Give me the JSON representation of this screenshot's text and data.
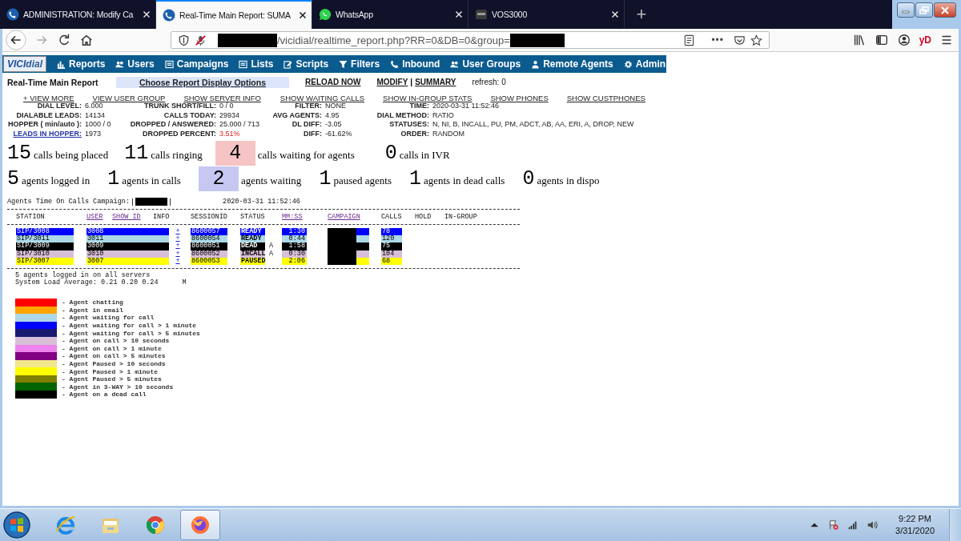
{
  "browser": {
    "tabs": [
      {
        "title": "ADMINISTRATION: Modify Ca",
        "kind": "vicidial",
        "selected": false
      },
      {
        "title": "Real-Time Main Report: SUMA",
        "kind": "vicidial",
        "selected": true
      },
      {
        "title": "WhatsApp",
        "kind": "whatsapp",
        "selected": false
      },
      {
        "title": "VOS3000",
        "kind": "vos",
        "selected": false
      }
    ],
    "new_tab": "+",
    "url": "/vicidial/realtime_report.php?RR=0&DB=0&group=",
    "more": "•••",
    "account_badge": "yD"
  },
  "menu": {
    "logo": {
      "bold": "VICI",
      "rest": "dial"
    },
    "items": [
      {
        "label": "Reports",
        "kind": "report"
      },
      {
        "label": "Users",
        "kind": "users"
      },
      {
        "label": "Campaigns",
        "kind": "list"
      },
      {
        "label": "Lists",
        "kind": "list"
      },
      {
        "label": "Scripts",
        "kind": "edit"
      },
      {
        "label": "Filters",
        "kind": "filter"
      },
      {
        "label": "Inbound",
        "kind": "phone"
      },
      {
        "label": "User Groups",
        "kind": "users"
      },
      {
        "label": "Remote Agents",
        "kind": "agent"
      },
      {
        "label": "Admin",
        "kind": "gear"
      }
    ]
  },
  "report": {
    "title": "Real-Time Main Report",
    "options_button": "Choose Report Display Options",
    "reload": "RELOAD NOW",
    "modify": "MODIFY",
    "separator": "|",
    "summary": "SUMMARY",
    "refresh": "refresh: 0",
    "links": [
      "+ VIEW MORE",
      "VIEW USER GROUP",
      "SHOW SERVER INFO",
      "SHOW WAITING CALLS",
      "SHOW IN-GROUP STATS",
      "SHOW PHONES",
      "SHOW CUSTPHONES"
    ],
    "stats": [
      [
        {
          "label": "DIAL LEVEL:",
          "value": "6.000"
        },
        {
          "label": "TRUNK SHORT/FILL:",
          "value": "0 / 0"
        },
        {
          "label": "FILTER:",
          "value": "NONE"
        },
        {
          "label": "TIME:",
          "value": "2020-03-31 11:52:46"
        }
      ],
      [
        {
          "label": "DIALABLE LEADS:",
          "value": "14134"
        },
        {
          "label": "CALLS TODAY:",
          "value": "29934"
        },
        {
          "label": "AVG AGENTS:",
          "value": "4.95"
        },
        {
          "label": "DIAL METHOD:",
          "value": "RATIO"
        }
      ],
      [
        {
          "label": "HOPPER ( min/auto ):",
          "value": "1000 / 0"
        },
        {
          "label": "DROPPED / ANSWERED:",
          "value": "25.000 / 713"
        },
        {
          "label": "DL DIFF:",
          "value": "-3.05"
        },
        {
          "label": "STATUSES:",
          "value": "N, NI, B, INCALL, PU, PM, ADCT, AB, AA, ERI, A, DROP, NEW"
        }
      ],
      [
        {
          "label": "LEADS IN HOPPER:",
          "value": "1973",
          "link": true
        },
        {
          "label": "DROPPED PERCENT:",
          "value": "3.51%",
          "alert": true
        },
        {
          "label": "DIFF:",
          "value": "-61.62%"
        },
        {
          "label": "ORDER:",
          "value": "RANDOM"
        }
      ]
    ]
  },
  "call_counts": [
    {
      "count": "15",
      "label": "calls being placed"
    },
    {
      "count": "11",
      "label": "calls ringing"
    },
    {
      "count": "4",
      "label": "calls waiting for agents",
      "color": "#f6c4c4"
    },
    {
      "count": "0",
      "label": "calls in IVR"
    }
  ],
  "agent_counts": [
    {
      "count": "5",
      "label": "agents logged in"
    },
    {
      "count": "1",
      "label": "agents in calls"
    },
    {
      "count": "2",
      "label": "agents waiting",
      "color": "#c6c8f2"
    },
    {
      "count": "1",
      "label": "paused agents"
    },
    {
      "count": "1",
      "label": "agents in dead calls"
    },
    {
      "count": "0",
      "label": "agents in dispo"
    }
  ],
  "agents": {
    "caption": "Agents Time On Calls Campaign:",
    "time": "2020-03-31 11:52:46",
    "columns": [
      {
        "label": "STATION",
        "link": false
      },
      {
        "label": "USER",
        "link": true
      },
      {
        "label": "SHOW ID",
        "link": true
      },
      {
        "label": "INFO",
        "link": false
      },
      {
        "label": "SESSIONID",
        "link": false
      },
      {
        "label": "STATUS",
        "link": false
      },
      {
        "label": "MM:SS",
        "link": true
      },
      {
        "label": "CAMPAIGN",
        "link": true
      },
      {
        "label": "CALLS",
        "link": false
      },
      {
        "label": "HOLD",
        "link": false
      },
      {
        "label": "IN-GROUP",
        "link": false
      }
    ],
    "rows": [
      {
        "station": "SIP/3008",
        "user": "3008",
        "info": "+",
        "session": "8600057",
        "status": "READY",
        "time": "1:30",
        "calls": "78",
        "color": "#0000ff"
      },
      {
        "station": "SIP/3011",
        "user": "3011",
        "info": "+",
        "session": "8600054",
        "status": "READY",
        "time": "0:44",
        "calls": "120",
        "color": "#add8e6"
      },
      {
        "station": "SIP/3009",
        "user": "3009",
        "info": "+",
        "session": "8600051",
        "status": "DEAD",
        "call_type": "A",
        "time": "1:58",
        "calls": "75",
        "color": "#000000"
      },
      {
        "station": "SIP/3010",
        "user": "3010",
        "info": "+",
        "session": "8600052",
        "status": "INCALL",
        "call_type": "A",
        "time": "0:30",
        "calls": "104",
        "color": "#d8bfd8"
      },
      {
        "station": "SIP/3007",
        "user": "3007",
        "info": "+",
        "session": "8600053",
        "status": "PAUSED",
        "time": "2:06",
        "calls": "68",
        "color": "#ffff00"
      }
    ],
    "summary": [
      "5 agents logged in on all servers",
      "System Load Average: 0.21 0.20 0.24"
    ],
    "load_flag": "M"
  },
  "legend": [
    {
      "color": "#ff0000",
      "label": "- Agent chatting"
    },
    {
      "color": "#ffa500",
      "label": "- Agent in email"
    },
    {
      "color": "#add8e6",
      "label": "- Agent waiting for call"
    },
    {
      "color": "#0000ff",
      "label": "- Agent waiting for call > 1 minute"
    },
    {
      "color": "#191970",
      "label": "- Agent waiting for call > 5 minutes"
    },
    {
      "color": "#d8bfd8",
      "label": "- Agent on call > 10 seconds"
    },
    {
      "color": "#ee82ee",
      "label": "- Agent on call > 1 minute"
    },
    {
      "color": "#800080",
      "label": "- Agent on call > 5 minutes"
    },
    {
      "color": "#f0e68c",
      "label": "- Agent Paused > 10 seconds"
    },
    {
      "color": "#ffff00",
      "label": "- Agent Paused > 1 minute"
    },
    {
      "color": "#808000",
      "label": "- Agent Paused > 5 minutes"
    },
    {
      "color": "#006400",
      "label": "- Agent in 3-WAY > 10 seconds"
    },
    {
      "color": "#000000",
      "label": "- Agent on a dead call"
    }
  ],
  "taskbar": {
    "apps": [
      {
        "kind": "ie",
        "selected": false
      },
      {
        "kind": "explorer",
        "selected": false
      },
      {
        "kind": "chrome",
        "selected": false
      },
      {
        "kind": "firefox",
        "selected": true
      }
    ],
    "time": "9:22 PM",
    "date": "3/31/2020"
  }
}
